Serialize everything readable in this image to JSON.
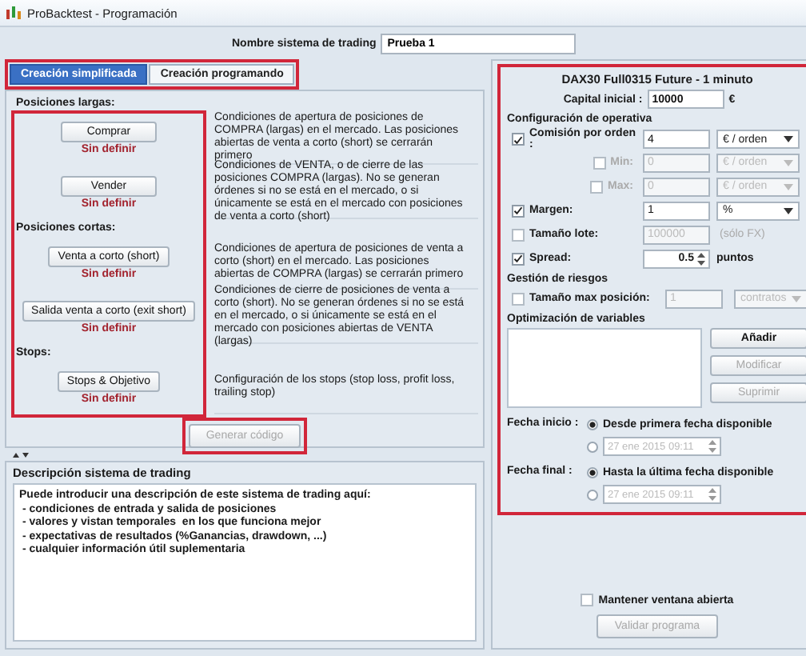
{
  "window": {
    "title": "ProBacktest - Programación"
  },
  "system_name": {
    "label": "Nombre sistema de trading",
    "value": "Prueba 1"
  },
  "tabs": [
    {
      "label": "Creación simplificada",
      "selected": true
    },
    {
      "label": "Creación programando",
      "selected": false
    }
  ],
  "sections": [
    {
      "heading": "Posiciones largas:",
      "actions": [
        {
          "button": "Comprar",
          "status": "Sin definir",
          "description": "Condiciones de apertura de posiciones de COMPRA (largas) en el mercado. Las posiciones abiertas de venta a corto (short) se cerrarán primero"
        },
        {
          "button": "Vender",
          "status": "Sin definir",
          "description": "Condiciones de VENTA, o de cierre de las posiciones COMPRA (largas). No se generan órdenes si no se está en el mercado, o si únicamente se está en el mercado con posiciones de venta a corto (short)"
        }
      ]
    },
    {
      "heading": "Posiciones cortas:",
      "actions": [
        {
          "button": "Venta a corto (short)",
          "status": "Sin definir",
          "description": "Condiciones de apertura de posiciones de venta a corto (short) en el mercado. Las posiciones abiertas de COMPRA (largas) se cerrarán primero"
        },
        {
          "button": "Salida venta a corto (exit short)",
          "status": "Sin definir",
          "description": "Condiciones de cierre de posiciones de venta a corto (short). No se generan órdenes si no se está en el mercado, o si únicamente se está en el mercado con posiciones abiertas de VENTA (largas)"
        }
      ]
    },
    {
      "heading": "Stops:",
      "actions": [
        {
          "button": "Stops & Objetivo",
          "status": "Sin definir",
          "description": "Configuración de los stops (stop loss, profit loss, trailing stop)"
        }
      ]
    }
  ],
  "generate_button": {
    "label": "Generar código",
    "disabled": true
  },
  "description_panel": {
    "title": "Descripción sistema de trading",
    "lines": [
      "Puede introducir una descripción de este sistema de trading aquí:",
      " - condiciones de entrada y salida de posiciones",
      " - valores y vistan temporales  en los que funciona mejor",
      " - expectativas de resultados (%Ganancias, drawdown, ...)",
      " - cualquier información útil suplementaria"
    ]
  },
  "settings": {
    "instrument": "DAX30 Full0315 Future - 1 minuto",
    "capital": {
      "label": "Capital inicial :",
      "value": "10000",
      "unit": "€"
    },
    "operation_heading": "Configuración de operativa",
    "operation": [
      {
        "kind": "select",
        "label": "Comisión por orden :",
        "checked": true,
        "value": "4",
        "unit": "€ / orden",
        "children": [
          {
            "kind": "select",
            "label": "Min:",
            "checked": false,
            "value": "0",
            "unit": "€ / orden"
          },
          {
            "kind": "select",
            "label": "Max:",
            "checked": false,
            "value": "0",
            "unit": "€ / orden"
          }
        ]
      },
      {
        "kind": "select",
        "label": "Margen:",
        "checked": true,
        "value": "1",
        "unit": "%"
      },
      {
        "kind": "note",
        "label": "Tamaño lote:",
        "checked": false,
        "value": "100000",
        "unit": "(sólo FX)"
      },
      {
        "kind": "spinner",
        "label": "Spread:",
        "checked": true,
        "value": "0.5",
        "unit": "puntos"
      }
    ],
    "risk_heading": "Gestión de riesgos",
    "risk": {
      "label": "Tamaño max posición:",
      "checked": false,
      "value": "1",
      "unit": "contratos"
    },
    "optimization_heading": "Optimización de variables",
    "optimization_buttons": [
      {
        "label": "Añadir",
        "disabled": false
      },
      {
        "label": "Modificar",
        "disabled": true
      },
      {
        "label": "Suprimir",
        "disabled": true
      }
    ],
    "dates": [
      {
        "label": "Fecha inicio :",
        "options": [
          {
            "kind": "text",
            "label": "Desde primera fecha disponible",
            "selected": true
          },
          {
            "kind": "date",
            "label": "27 ene 2015 09:11",
            "selected": false
          }
        ]
      },
      {
        "label": "Fecha final :",
        "options": [
          {
            "kind": "text",
            "label": "Hasta la última fecha disponible",
            "selected": true
          },
          {
            "kind": "date",
            "label": "27 ene 2015 09:11",
            "selected": false
          }
        ]
      }
    ]
  },
  "keep_open": {
    "label": "Mantener ventana abierta",
    "checked": false
  },
  "validate_button": {
    "label": "Validar programa",
    "disabled": true
  }
}
